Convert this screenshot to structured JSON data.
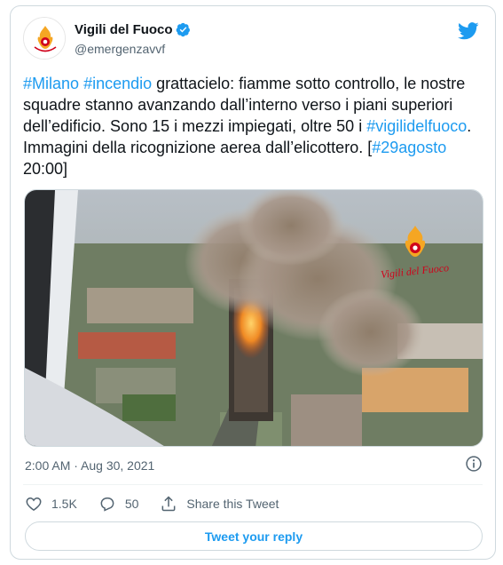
{
  "header": {
    "display_name": "Vigili del Fuoco",
    "handle": "@emergenzavvf",
    "verified": true
  },
  "tweet": {
    "segments": [
      {
        "text": "#Milano",
        "link": true
      },
      {
        "text": " ",
        "link": false
      },
      {
        "text": "#incendio",
        "link": true
      },
      {
        "text": " grattacielo: fiamme sotto controllo, le nostre squadre stanno avanzando dall’interno verso i piani superiori dell’edificio. Sono 15 i mezzi impiegati, oltre 50 i ",
        "link": false
      },
      {
        "text": "#vigilidelfuoco",
        "link": true
      },
      {
        "text": ". Immagini della ricognizione aerea dall’elicottero.    [",
        "link": false
      },
      {
        "text": "#29agosto",
        "link": true
      },
      {
        "text": " 20:00]",
        "link": false
      }
    ]
  },
  "media": {
    "watermark": "Vigili del Fuoco"
  },
  "meta": {
    "timestamp": "2:00 AM · Aug 30, 2021"
  },
  "actions": {
    "likes": "1.5K",
    "replies": "50",
    "share_label": "Share this Tweet"
  },
  "reply_button": "Tweet your reply",
  "colors": {
    "accent": "#1d9bf0",
    "text": "#0f1419",
    "muted": "#536471"
  }
}
